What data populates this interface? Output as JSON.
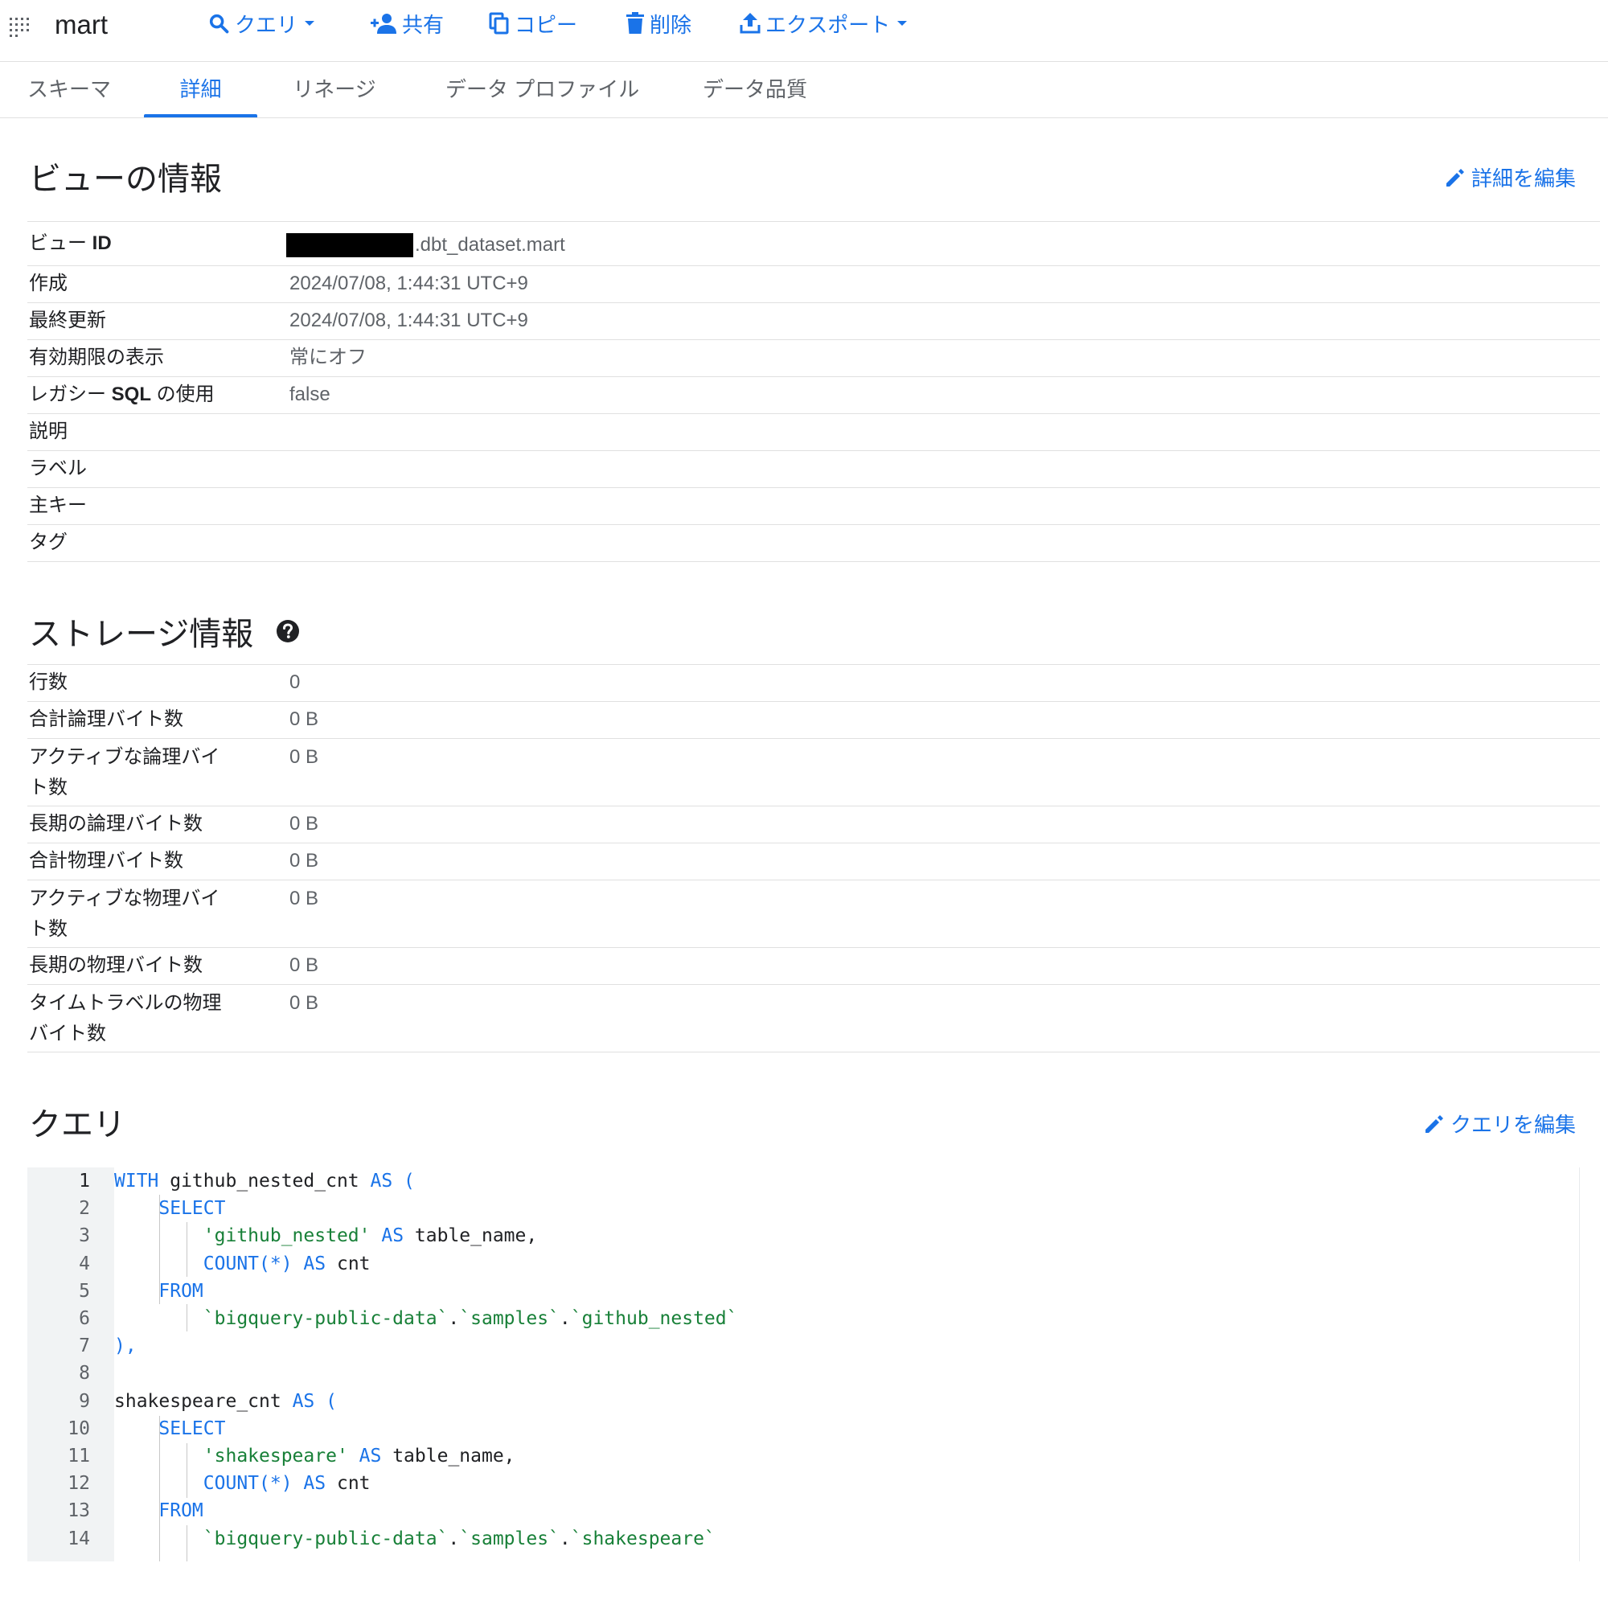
{
  "toolbar": {
    "title": "mart",
    "query_label": "クエリ",
    "share_label": "共有",
    "copy_label": "コピー",
    "delete_label": "削除",
    "export_label": "エクスポート"
  },
  "tabs": [
    "スキーマ",
    "詳細",
    "リネージ",
    "データ プロファイル",
    "データ品質"
  ],
  "view_info": {
    "title": "ビューの情報",
    "edit_label": "詳細を編集",
    "rows": [
      {
        "key_prefix": "ビュー ",
        "key_bold": "ID",
        "value": ".dbt_dataset.mart"
      },
      {
        "key": "作成",
        "value": "2024/07/08, 1:44:31 UTC+9"
      },
      {
        "key": "最終更新",
        "value": "2024/07/08, 1:44:31 UTC+9"
      },
      {
        "key": "有効期限の表示",
        "value": "常にオフ"
      },
      {
        "key_prefix": "レガシー ",
        "key_bold": "SQL",
        "key_suffix": " の使用",
        "value": "false"
      },
      {
        "key": "説明",
        "value": ""
      },
      {
        "key": "ラベル",
        "value": ""
      },
      {
        "key": "主キー",
        "value": ""
      },
      {
        "key": "タグ",
        "value": ""
      }
    ]
  },
  "storage_info": {
    "title": "ストレージ情報",
    "rows": [
      {
        "key": "行数",
        "value": "0"
      },
      {
        "key": "合計論理バイト数",
        "value": "0 B"
      },
      {
        "key": "アクティブな論理バイ\nト数",
        "value": "0 B"
      },
      {
        "key": "長期の論理バイト数",
        "value": "0 B"
      },
      {
        "key": "合計物理バイト数",
        "value": "0 B"
      },
      {
        "key": "アクティブな物理バイ\nト数",
        "value": "0 B"
      },
      {
        "key": "長期の物理バイト数",
        "value": "0 B"
      },
      {
        "key": "タイムトラベルの物理\nバイト数",
        "value": "0 B"
      }
    ]
  },
  "query": {
    "title": "クエリ",
    "edit_label": "クエリを編集",
    "lines": [
      {
        "n": "1",
        "t": [
          [
            "kw",
            "WITH"
          ],
          [
            "p",
            " github_nested_cnt "
          ],
          [
            "kw",
            "AS ("
          ]
        ]
      },
      {
        "n": "2",
        "t": [
          [
            "kw",
            "    SELECT"
          ]
        ]
      },
      {
        "n": "3",
        "t": [
          [
            "str",
            "        'github_nested'"
          ],
          [
            "p",
            " "
          ],
          [
            "kw",
            "AS"
          ],
          [
            "p",
            " table_name,"
          ]
        ]
      },
      {
        "n": "4",
        "t": [
          [
            "kw",
            "        COUNT(*)"
          ],
          [
            "p",
            " "
          ],
          [
            "kw",
            "AS"
          ],
          [
            "p",
            " cnt"
          ]
        ]
      },
      {
        "n": "5",
        "t": [
          [
            "kw",
            "    FROM"
          ]
        ]
      },
      {
        "n": "6",
        "t": [
          [
            "str",
            "        `bigquery-public-data`"
          ],
          [
            "p",
            "."
          ],
          [
            "str",
            "`samples`"
          ],
          [
            "p",
            "."
          ],
          [
            "str",
            "`github_nested`"
          ]
        ]
      },
      {
        "n": "7",
        "t": [
          [
            "kw",
            "),"
          ]
        ]
      },
      {
        "n": "8",
        "t": []
      },
      {
        "n": "9",
        "t": [
          [
            "p",
            "shakespeare_cnt "
          ],
          [
            "kw",
            "AS ("
          ]
        ]
      },
      {
        "n": "10",
        "t": [
          [
            "kw",
            "    SELECT"
          ]
        ]
      },
      {
        "n": "11",
        "t": [
          [
            "str",
            "        'shakespeare'"
          ],
          [
            "p",
            " "
          ],
          [
            "kw",
            "AS"
          ],
          [
            "p",
            " table_name,"
          ]
        ]
      },
      {
        "n": "12",
        "t": [
          [
            "kw",
            "        COUNT(*)"
          ],
          [
            "p",
            " "
          ],
          [
            "kw",
            "AS"
          ],
          [
            "p",
            " cnt"
          ]
        ]
      },
      {
        "n": "13",
        "t": [
          [
            "kw",
            "    FROM"
          ]
        ]
      },
      {
        "n": "14",
        "t": [
          [
            "str",
            "        `bigquery-public-data`"
          ],
          [
            "p",
            "."
          ],
          [
            "str",
            "`samples`"
          ],
          [
            "p",
            "."
          ],
          [
            "str",
            "`shakespeare`"
          ]
        ]
      }
    ]
  },
  "colors": {
    "accent": "#1a73e8",
    "keyword": "#1a73e8",
    "string": "#188038",
    "divider": "#e0e0e0"
  }
}
